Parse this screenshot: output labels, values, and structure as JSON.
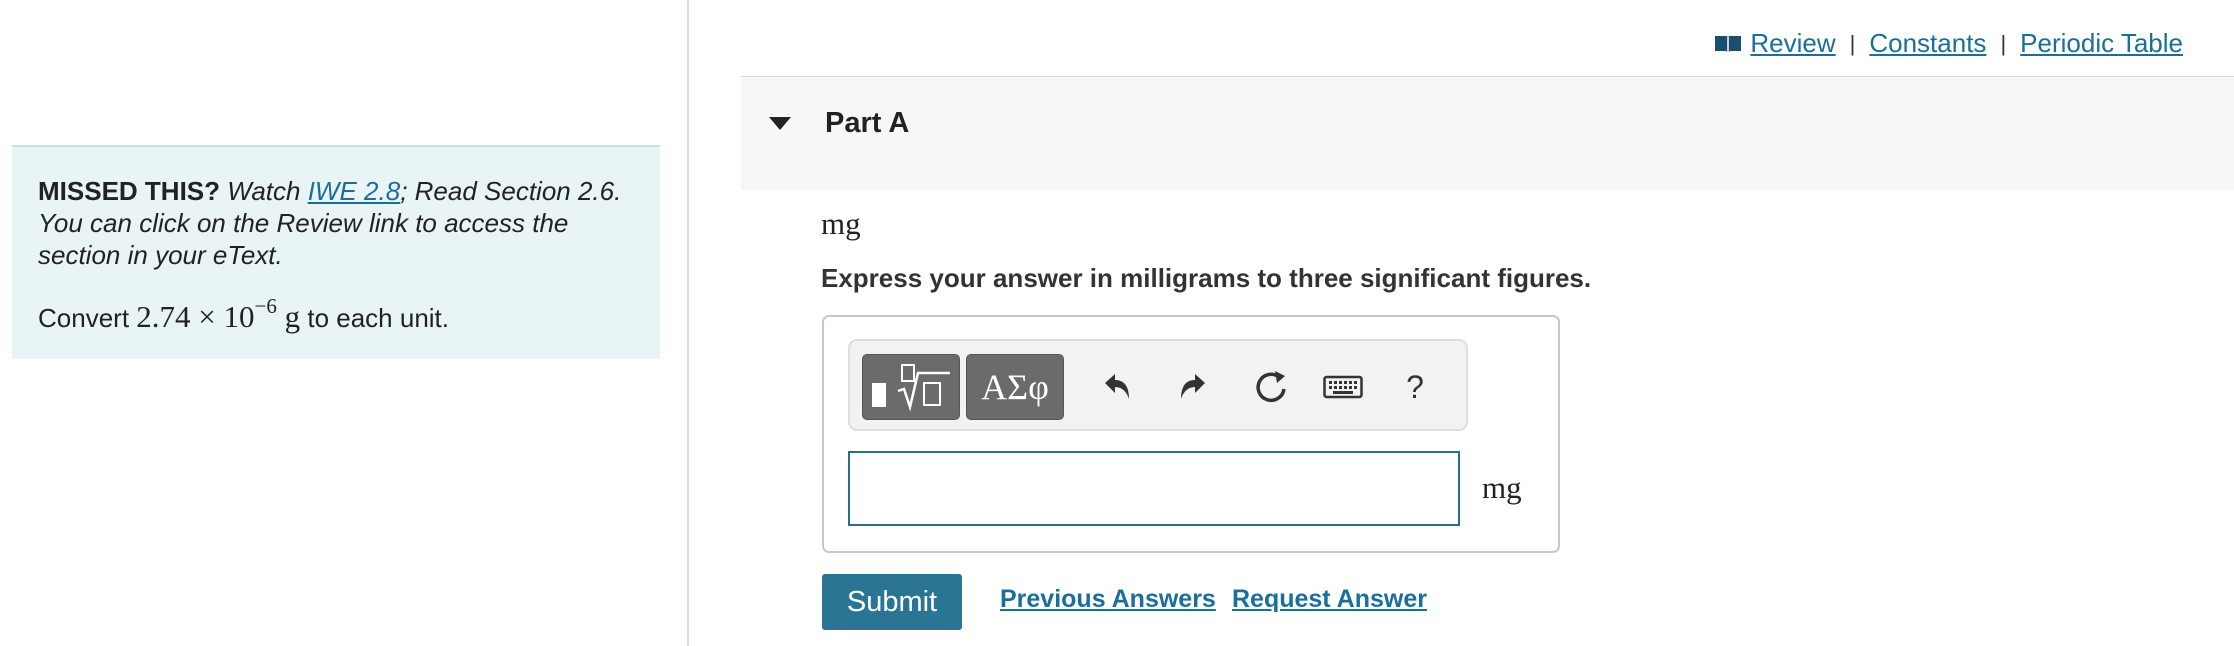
{
  "top_links": {
    "review": "Review",
    "constants": "Constants",
    "periodic_table": "Periodic Table",
    "separator": "|"
  },
  "hint": {
    "missed_label": "MISSED THIS?",
    "watch_text": "Watch",
    "video_link": "IWE 2.8",
    "read_text": "; Read Section 2.6. You can click on the Review link to access the section in your eText.",
    "convert_prefix": "Convert",
    "value_mantissa": "2.74 × 10",
    "value_exponent": "−6",
    "value_unit": "g",
    "convert_suffix": "to each unit."
  },
  "part": {
    "title": "Part A",
    "unit": "mg",
    "instructions": "Express your answer in milligrams to three significant figures."
  },
  "toolbar": {
    "symbols_label": "ΑΣφ",
    "help_label": "?"
  },
  "answer": {
    "value": "",
    "unit": "mg"
  },
  "actions": {
    "submit": "Submit",
    "previous_answers": "Previous Answers",
    "request_answer": "Request Answer"
  },
  "colors": {
    "link": "#1a6f9a",
    "submit_bg": "#2a7494",
    "hint_bg": "#e8f4f6",
    "input_border": "#2a6c8a"
  }
}
